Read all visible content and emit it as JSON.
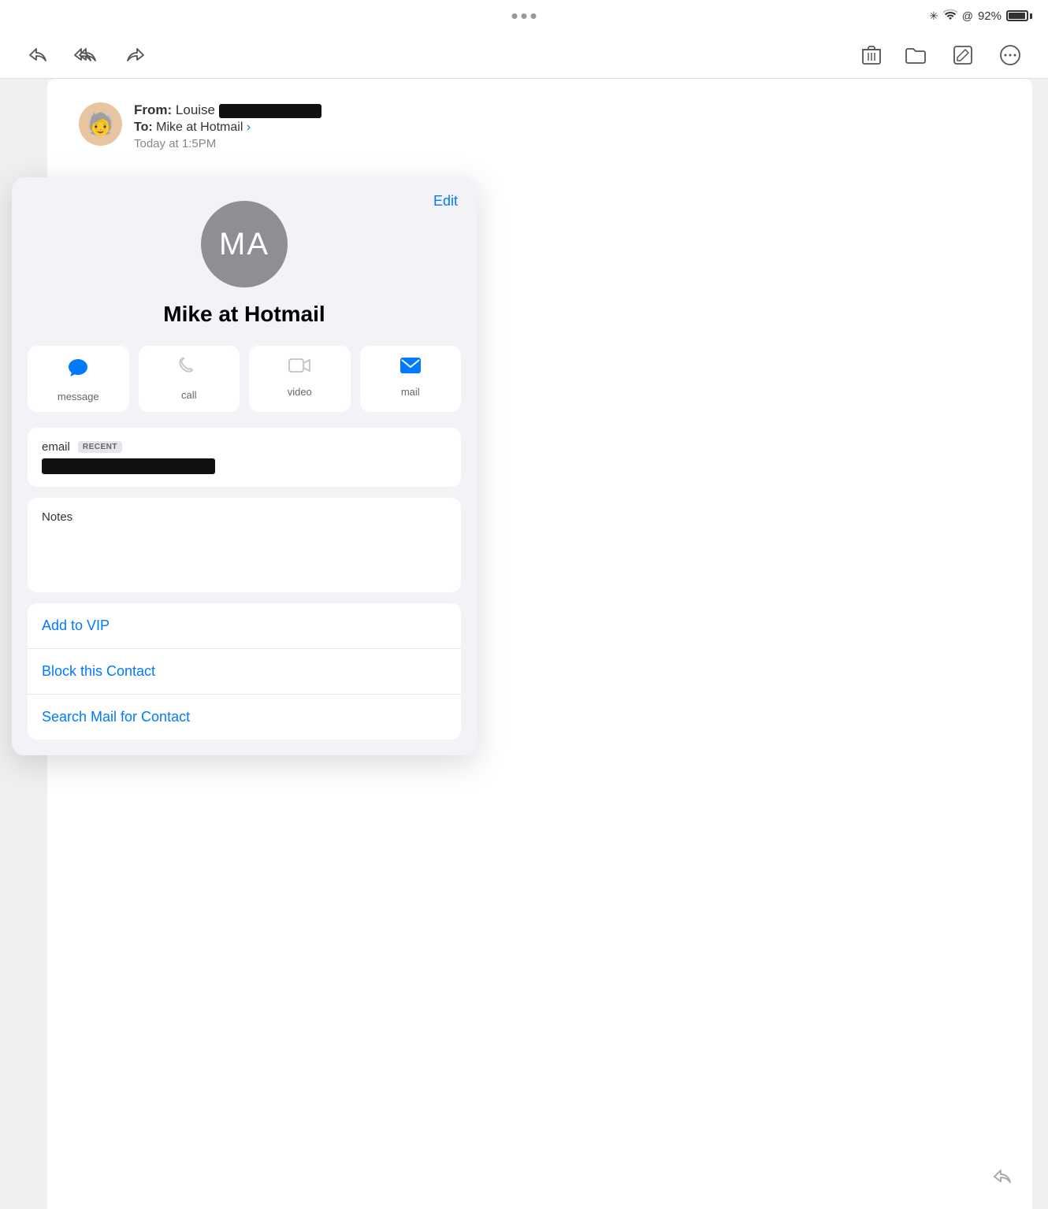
{
  "statusBar": {
    "battery": "92%",
    "dots": [
      "•",
      "•",
      "•"
    ]
  },
  "toolbar": {
    "replyLabel": "↩",
    "replyAllLabel": "↩↩",
    "forwardLabel": "↪",
    "deleteLabel": "🗑",
    "folderLabel": "📁",
    "composeLabel": "✏",
    "moreLabel": "···"
  },
  "emailHeader": {
    "fromLabel": "From:",
    "fromName": "Louise",
    "toLabel": "To:",
    "toName": "Mike at Hotmail",
    "timeLabel": "Today at 1:5",
    "timeSuffix": "PM"
  },
  "contactPanel": {
    "editLabel": "Edit",
    "avatarInitials": "MA",
    "contactName": "Mike at Hotmail",
    "actions": [
      {
        "id": "message",
        "label": "message",
        "color": "blue"
      },
      {
        "id": "call",
        "label": "call",
        "color": "gray"
      },
      {
        "id": "video",
        "label": "video",
        "color": "gray"
      },
      {
        "id": "mail",
        "label": "mail",
        "color": "blue"
      }
    ],
    "emailFieldLabel": "email",
    "recentBadge": "RECENT",
    "notesLabel": "Notes",
    "addToVIP": "Add to VIP",
    "blockContact": "Block this Contact",
    "searchMail": "Search Mail for Contact"
  }
}
